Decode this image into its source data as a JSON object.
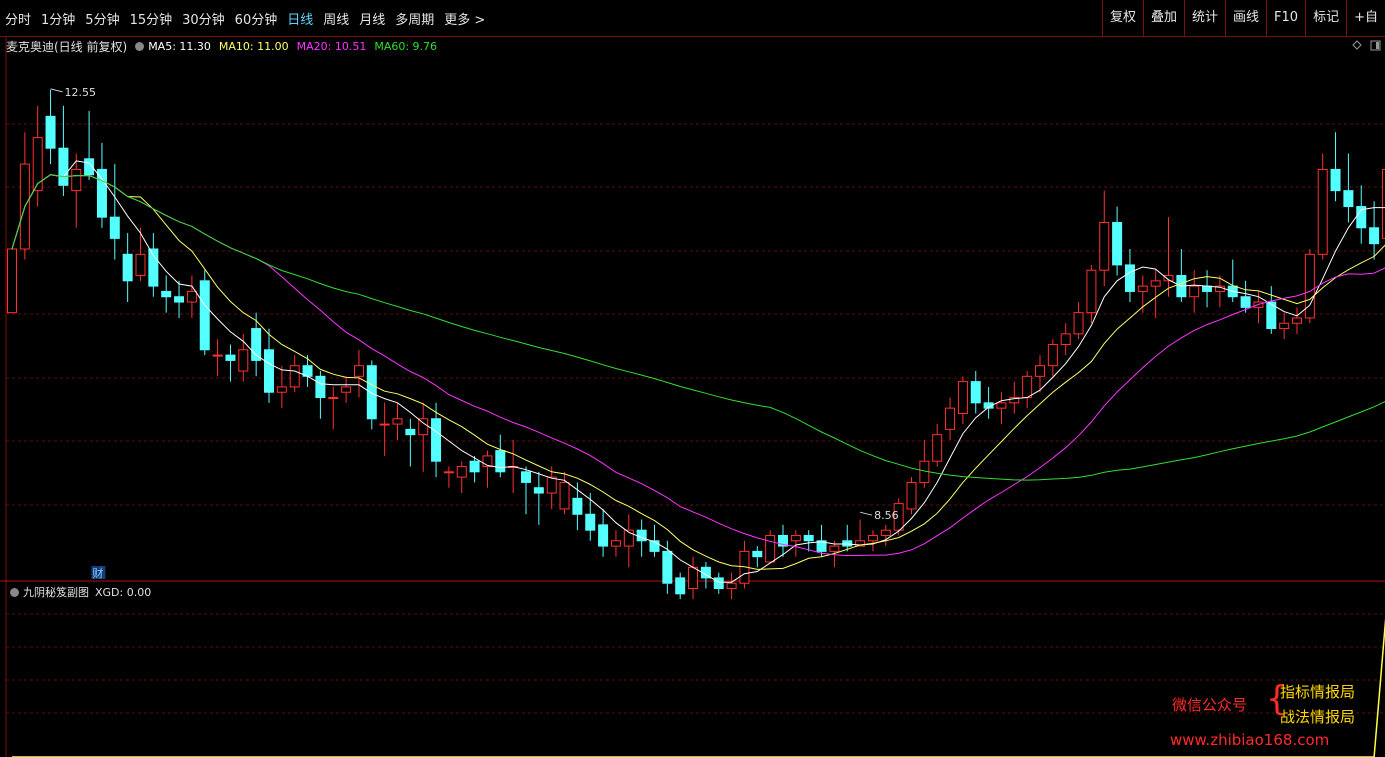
{
  "toolbar": {
    "periods": [
      "分时",
      "1分钟",
      "5分钟",
      "15分钟",
      "30分钟",
      "60分钟",
      "日线",
      "周线",
      "月线",
      "多周期",
      "更多 >"
    ],
    "active_period": "日线",
    "tools": [
      "复权",
      "叠加",
      "统计",
      "画线",
      "F10",
      "标记",
      "+自"
    ]
  },
  "legend": {
    "title": "麦克奥迪(日线 前复权)",
    "ma5": "MA5: 11.30",
    "ma10": "MA10: 11.00",
    "ma20": "MA20: 10.51",
    "ma60": "MA60: 9.76"
  },
  "colors": {
    "up": "#ff3030",
    "down": "#54ffff",
    "ma5": "#ffffff",
    "ma10": "#ffff66",
    "ma20": "#ff33ff",
    "ma60": "#33dd33",
    "grid": "#5a0f0f",
    "xgd": "#ffff44"
  },
  "sub": {
    "title": "九阴秘笈副图",
    "value": "XGD: 0.00"
  },
  "watermark": {
    "wechat": "微信公众号",
    "brace": "{",
    "a": "指标情报局",
    "b": "战法情报局",
    "url": "www.zhibiao168.com"
  },
  "chart_data": [
    {
      "type": "candlestick",
      "title": "麦克奥迪(日线 前复权)",
      "ylim": [
        8.1,
        12.85
      ],
      "annotations": [
        {
          "label": "12.55",
          "at": 3,
          "value": 12.55
        },
        {
          "label": "8.56",
          "at": 66,
          "value": 8.56
        },
        {
          "label": "财",
          "at": 4,
          "kind": "badge"
        }
      ],
      "ohlc": [
        [
          10.45,
          11.05,
          10.45,
          11.05
        ],
        [
          11.05,
          12.15,
          10.95,
          11.85
        ],
        [
          11.6,
          12.4,
          11.45,
          12.1
        ],
        [
          12.3,
          12.55,
          11.85,
          12.0
        ],
        [
          12.0,
          12.4,
          11.55,
          11.65
        ],
        [
          11.6,
          11.95,
          11.25,
          11.8
        ],
        [
          11.9,
          12.35,
          11.7,
          11.75
        ],
        [
          11.8,
          12.05,
          11.25,
          11.35
        ],
        [
          11.35,
          11.85,
          10.95,
          11.15
        ],
        [
          11.0,
          11.2,
          10.55,
          10.75
        ],
        [
          10.8,
          11.25,
          10.75,
          11.0
        ],
        [
          11.05,
          11.2,
          10.6,
          10.7
        ],
        [
          10.65,
          10.8,
          10.45,
          10.6
        ],
        [
          10.6,
          10.75,
          10.4,
          10.55
        ],
        [
          10.55,
          10.8,
          10.4,
          10.65
        ],
        [
          10.75,
          10.85,
          10.05,
          10.1
        ],
        [
          10.05,
          10.2,
          9.85,
          10.05
        ],
        [
          10.05,
          10.15,
          9.8,
          10.0
        ],
        [
          9.9,
          10.25,
          9.8,
          10.1
        ],
        [
          10.3,
          10.45,
          9.85,
          10.0
        ],
        [
          10.1,
          10.3,
          9.6,
          9.7
        ],
        [
          9.7,
          9.95,
          9.55,
          9.75
        ],
        [
          9.75,
          10.05,
          9.7,
          9.95
        ],
        [
          9.95,
          10.05,
          9.75,
          9.85
        ],
        [
          9.85,
          9.9,
          9.45,
          9.65
        ],
        [
          9.65,
          9.75,
          9.35,
          9.65
        ],
        [
          9.7,
          9.85,
          9.6,
          9.75
        ],
        [
          9.85,
          10.1,
          9.65,
          9.95
        ],
        [
          9.95,
          10.0,
          9.35,
          9.45
        ],
        [
          9.4,
          9.6,
          9.1,
          9.4
        ],
        [
          9.4,
          9.6,
          9.25,
          9.45
        ],
        [
          9.35,
          9.45,
          9.0,
          9.3
        ],
        [
          9.3,
          9.6,
          8.95,
          9.45
        ],
        [
          9.45,
          9.6,
          8.9,
          9.05
        ],
        [
          8.95,
          9.0,
          8.8,
          8.95
        ],
        [
          8.9,
          9.05,
          8.75,
          9.0
        ],
        [
          9.05,
          9.1,
          8.85,
          8.95
        ],
        [
          9.0,
          9.15,
          8.8,
          9.1
        ],
        [
          9.15,
          9.3,
          8.9,
          8.95
        ],
        [
          9.0,
          9.25,
          8.75,
          9.0
        ],
        [
          8.95,
          9.0,
          8.55,
          8.85
        ],
        [
          8.8,
          8.95,
          8.45,
          8.75
        ],
        [
          8.75,
          9.0,
          8.6,
          8.9
        ],
        [
          8.6,
          8.95,
          8.55,
          8.85
        ],
        [
          8.7,
          8.85,
          8.4,
          8.55
        ],
        [
          8.55,
          8.75,
          8.3,
          8.4
        ],
        [
          8.45,
          8.6,
          8.15,
          8.25
        ],
        [
          8.25,
          8.4,
          8.15,
          8.3
        ],
        [
          8.25,
          8.55,
          8.05,
          8.4
        ],
        [
          8.4,
          8.5,
          8.15,
          8.3
        ],
        [
          8.3,
          8.45,
          8.15,
          8.2
        ],
        [
          8.2,
          8.3,
          7.8,
          7.9
        ],
        [
          7.95,
          8.0,
          7.75,
          7.8
        ],
        [
          7.85,
          8.15,
          7.75,
          8.05
        ],
        [
          8.05,
          8.1,
          7.85,
          7.95
        ],
        [
          7.95,
          8.0,
          7.8,
          7.85
        ],
        [
          7.85,
          8.0,
          7.75,
          7.9
        ],
        [
          7.9,
          8.3,
          7.85,
          8.2
        ],
        [
          8.2,
          8.25,
          8.05,
          8.15
        ],
        [
          8.1,
          8.4,
          8.1,
          8.35
        ],
        [
          8.35,
          8.45,
          8.15,
          8.25
        ],
        [
          8.3,
          8.4,
          8.15,
          8.35
        ],
        [
          8.35,
          8.4,
          8.2,
          8.3
        ],
        [
          8.3,
          8.45,
          8.15,
          8.2
        ],
        [
          8.2,
          8.3,
          8.05,
          8.25
        ],
        [
          8.3,
          8.45,
          8.2,
          8.25
        ],
        [
          8.25,
          8.5,
          8.25,
          8.3
        ],
        [
          8.3,
          8.4,
          8.2,
          8.35
        ],
        [
          8.35,
          8.45,
          8.25,
          8.4
        ],
        [
          8.4,
          8.7,
          8.35,
          8.65
        ],
        [
          8.6,
          8.9,
          8.55,
          8.85
        ],
        [
          8.85,
          9.25,
          8.8,
          9.05
        ],
        [
          9.05,
          9.4,
          9.0,
          9.3
        ],
        [
          9.35,
          9.65,
          9.25,
          9.55
        ],
        [
          9.5,
          9.85,
          9.4,
          9.8
        ],
        [
          9.8,
          9.9,
          9.5,
          9.6
        ],
        [
          9.6,
          9.75,
          9.45,
          9.55
        ],
        [
          9.55,
          9.7,
          9.4,
          9.6
        ],
        [
          9.6,
          9.8,
          9.5,
          9.65
        ],
        [
          9.65,
          9.9,
          9.55,
          9.85
        ],
        [
          9.85,
          10.05,
          9.7,
          9.95
        ],
        [
          9.95,
          10.2,
          9.85,
          10.15
        ],
        [
          10.15,
          10.35,
          10.05,
          10.25
        ],
        [
          10.25,
          10.55,
          10.2,
          10.45
        ],
        [
          10.45,
          10.9,
          10.35,
          10.85
        ],
        [
          10.85,
          11.6,
          10.7,
          11.3
        ],
        [
          11.3,
          11.45,
          10.8,
          10.9
        ],
        [
          10.9,
          11.05,
          10.55,
          10.65
        ],
        [
          10.65,
          10.8,
          10.45,
          10.7
        ],
        [
          10.7,
          10.85,
          10.4,
          10.75
        ],
        [
          10.75,
          11.35,
          10.6,
          10.8
        ],
        [
          10.8,
          11.05,
          10.55,
          10.6
        ],
        [
          10.6,
          10.85,
          10.45,
          10.7
        ],
        [
          10.7,
          10.85,
          10.5,
          10.65
        ],
        [
          10.65,
          10.8,
          10.5,
          10.7
        ],
        [
          10.7,
          10.95,
          10.55,
          10.6
        ],
        [
          10.6,
          10.75,
          10.45,
          10.5
        ],
        [
          10.5,
          10.65,
          10.35,
          10.55
        ],
        [
          10.55,
          10.7,
          10.25,
          10.3
        ],
        [
          10.3,
          10.45,
          10.2,
          10.35
        ],
        [
          10.35,
          10.5,
          10.25,
          10.4
        ],
        [
          10.4,
          11.05,
          10.35,
          11.0
        ],
        [
          11.0,
          11.95,
          10.95,
          11.8
        ],
        [
          11.8,
          12.15,
          11.5,
          11.6
        ],
        [
          11.6,
          11.95,
          11.3,
          11.45
        ],
        [
          11.45,
          11.65,
          11.1,
          11.25
        ],
        [
          11.25,
          11.5,
          10.95,
          11.1
        ],
        [
          11.15,
          11.85,
          11.05,
          11.8
        ],
        [
          11.75,
          12.05,
          11.2,
          11.45
        ],
        [
          11.45,
          11.55,
          11.2,
          11.35
        ]
      ]
    },
    {
      "type": "line",
      "title": "九阴秘笈副图",
      "series": [
        {
          "name": "XGD",
          "values": [
            0,
            0,
            0,
            0,
            0,
            0,
            0,
            0,
            0,
            0,
            0,
            0,
            0,
            0,
            0,
            0,
            0,
            0,
            0,
            0,
            0,
            0,
            0,
            0,
            0,
            0,
            0,
            0,
            0,
            0,
            0,
            0,
            0,
            0,
            0,
            0,
            0,
            0,
            0,
            0,
            0,
            0,
            0,
            0,
            0,
            0,
            0,
            0,
            0,
            0,
            0,
            0,
            0,
            0,
            0,
            0,
            0,
            0,
            0,
            0,
            0,
            0,
            0,
            0,
            0,
            0,
            0,
            0,
            0,
            0,
            0,
            0,
            0,
            0,
            0,
            0,
            0,
            0,
            0,
            0,
            0,
            0,
            0,
            0,
            0,
            0,
            0,
            0,
            0,
            0,
            0,
            0,
            0,
            0,
            0,
            0,
            0,
            0,
            0,
            0,
            0,
            0,
            0,
            0,
            0,
            0,
            0,
            1,
            0,
            0
          ]
        }
      ],
      "ylim": [
        0,
        1
      ]
    }
  ]
}
